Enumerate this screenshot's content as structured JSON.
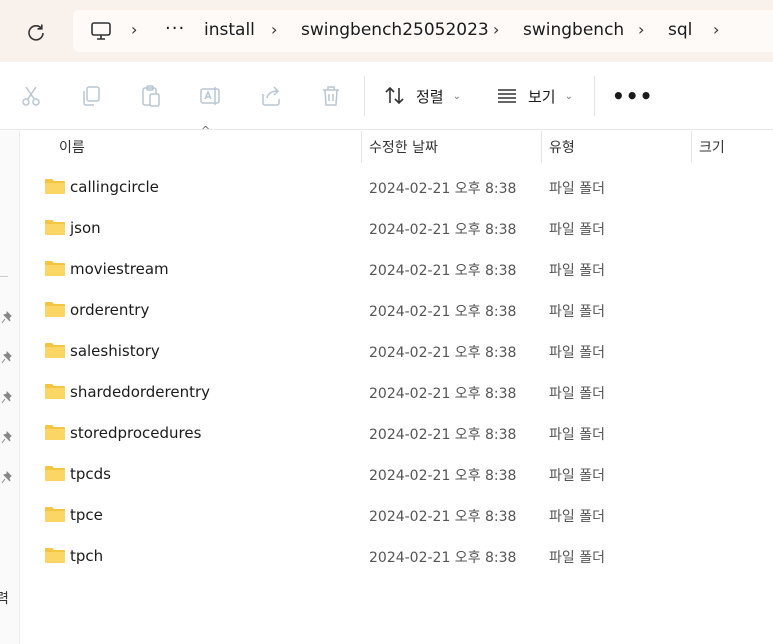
{
  "address_bar": {
    "overflow": "···",
    "crumbs": [
      "install",
      "swingbench25052023",
      "swingbench",
      "sql"
    ]
  },
  "toolbar": {
    "sort_label": "정렬",
    "view_label": "보기",
    "more": "•••"
  },
  "columns": {
    "name": "이름",
    "modified": "수정한 날짜",
    "type": "유형",
    "size": "크기"
  },
  "files": [
    {
      "name": "callingcircle",
      "modified": "2024-02-21 오후 8:38",
      "type": "파일 폴더"
    },
    {
      "name": "json",
      "modified": "2024-02-21 오후 8:38",
      "type": "파일 폴더"
    },
    {
      "name": "moviestream",
      "modified": "2024-02-21 오후 8:38",
      "type": "파일 폴더"
    },
    {
      "name": "orderentry",
      "modified": "2024-02-21 오후 8:38",
      "type": "파일 폴더"
    },
    {
      "name": "saleshistory",
      "modified": "2024-02-21 오후 8:38",
      "type": "파일 폴더"
    },
    {
      "name": "shardedorderentry",
      "modified": "2024-02-21 오후 8:38",
      "type": "파일 폴더"
    },
    {
      "name": "storedprocedures",
      "modified": "2024-02-21 오후 8:38",
      "type": "파일 폴더"
    },
    {
      "name": "tpcds",
      "modified": "2024-02-21 오후 8:38",
      "type": "파일 폴더"
    },
    {
      "name": "tpce",
      "modified": "2024-02-21 오후 8:38",
      "type": "파일 폴더"
    },
    {
      "name": "tpch",
      "modified": "2024-02-21 오후 8:38",
      "type": "파일 폴더"
    }
  ],
  "left_pane": {
    "partial_text": "력"
  },
  "colors": {
    "address_band": "#f9f1ec",
    "folder": "#f4c542"
  }
}
